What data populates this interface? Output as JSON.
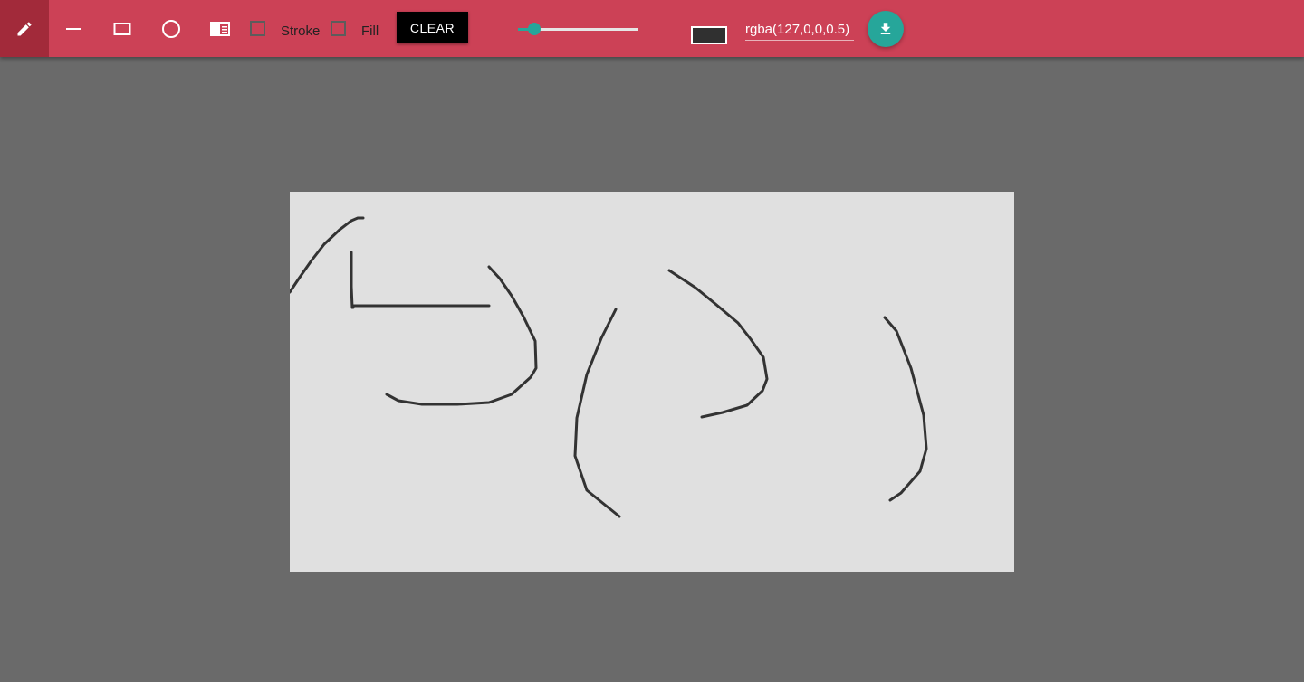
{
  "toolbar": {
    "tools": [
      {
        "name": "pencil-icon",
        "active": true
      },
      {
        "name": "line-icon",
        "active": false
      },
      {
        "name": "rectangle-icon",
        "active": false
      },
      {
        "name": "circle-icon",
        "active": false
      },
      {
        "name": "image-icon",
        "active": false
      }
    ],
    "stroke_label": "Stroke",
    "stroke_checked": false,
    "fill_label": "Fill",
    "fill_checked": false,
    "clear_label": "CLEAR",
    "brush_size_fraction": 0.14,
    "color_swatch": "#303030",
    "color_value": "rgba(127,0,0,0.5)",
    "download_icon": "download-icon"
  },
  "colors": {
    "toolbar": "#cc4156",
    "active_tool": "#a22a3a",
    "accent": "#26a69a",
    "workspace": "#6a6a6a",
    "canvas": "#e0e0e0",
    "stroke": "#333333"
  }
}
